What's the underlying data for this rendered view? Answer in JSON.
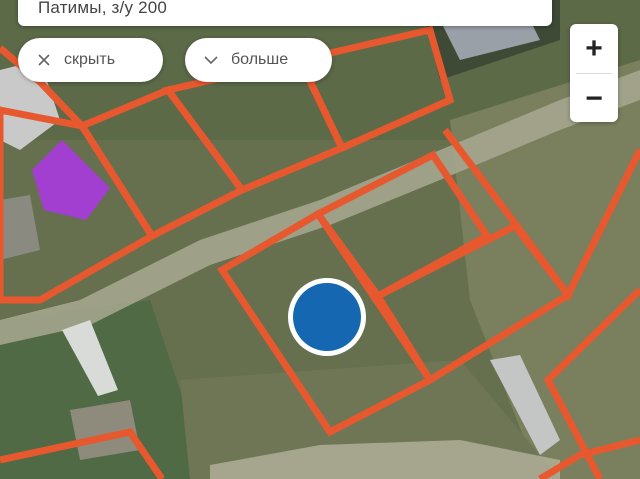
{
  "search": {
    "query": "Патимы, з/у 200"
  },
  "chips": {
    "hide_label": "скрыть",
    "more_label": "больше"
  },
  "zoom": {
    "in_label": "+",
    "out_label": "−"
  },
  "colors": {
    "parcel_border": "#e8582f",
    "selected_building": "#a23fd1",
    "location_marker": "#1467b0",
    "marker_ring": "#ffffff"
  },
  "icons": {
    "hide": "close-icon",
    "more": "chevron-down-icon"
  }
}
